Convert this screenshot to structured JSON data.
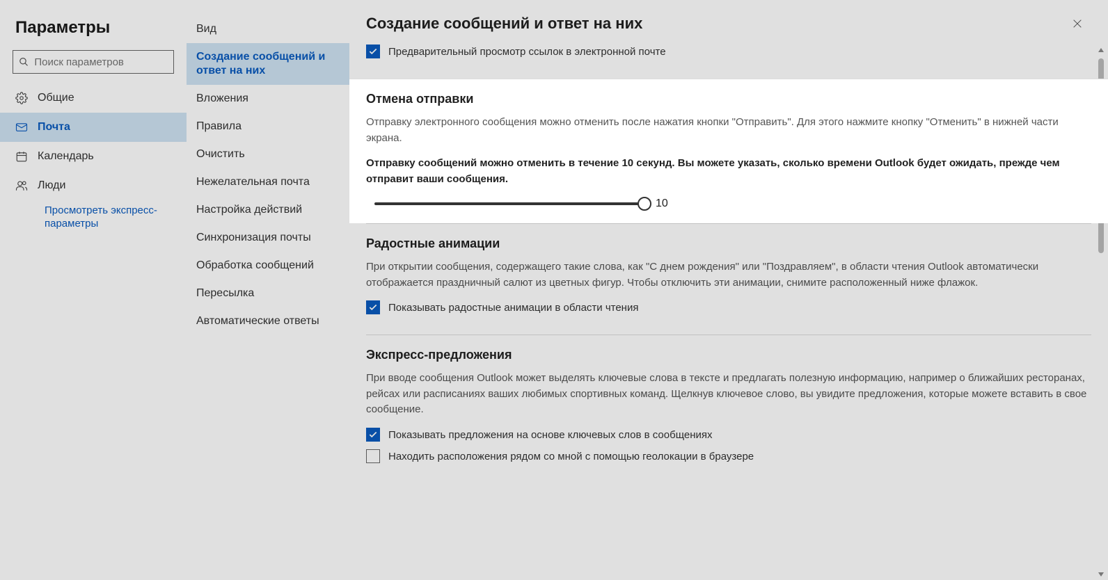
{
  "header": {
    "title": "Параметры"
  },
  "search": {
    "placeholder": "Поиск параметров"
  },
  "categories": [
    {
      "id": "general",
      "label": "Общие"
    },
    {
      "id": "mail",
      "label": "Почта"
    },
    {
      "id": "calendar",
      "label": "Календарь"
    },
    {
      "id": "people",
      "label": "Люди"
    }
  ],
  "quick_link": "Просмотреть экспресс-параметры",
  "sub_items": [
    "Вид",
    "Создание сообщений и ответ на них",
    "Вложения",
    "Правила",
    "Очистить",
    "Нежелательная почта",
    "Настройка действий",
    "Синхронизация почты",
    "Обработка сообщений",
    "Пересылка",
    "Автоматические ответы"
  ],
  "panel": {
    "title": "Создание сообщений и ответ на них",
    "link_preview": {
      "label": "Предварительный просмотр ссылок в электронной почте"
    },
    "undo": {
      "title": "Отмена отправки",
      "desc": "Отправку электронного сообщения можно отменить после нажатия кнопки \"Отправить\". Для этого нажмите кнопку \"Отменить\" в нижней части экрана.",
      "bold": "Отправку сообщений можно отменить в течение 10 секунд. Вы можете указать, сколько времени Outlook будет ожидать, прежде чем отправит ваши сообщения.",
      "value": "10"
    },
    "joyful": {
      "title": "Радостные анимации",
      "desc": "При открытии сообщения, содержащего такие слова, как \"С днем рождения\" или \"Поздравляем\", в области чтения Outlook автоматически отображается праздничный салют из цветных фигур. Чтобы отключить эти анимации, снимите расположенный ниже флажок.",
      "chk_label": "Показывать радостные анимации в области чтения"
    },
    "suggest": {
      "title": "Экспресс-предложения",
      "desc": "При вводе сообщения Outlook может выделять ключевые слова в тексте и предлагать полезную информацию, например о ближайших ресторанах, рейсах или расписаниях ваших любимых спортивных команд. Щелкнув ключевое слово, вы увидите предложения, которые можете вставить в свое сообщение.",
      "chk1_label": "Показывать предложения на основе ключевых слов в сообщениях",
      "chk2_label": "Находить расположения рядом со мной с помощью геолокации в браузере"
    }
  }
}
